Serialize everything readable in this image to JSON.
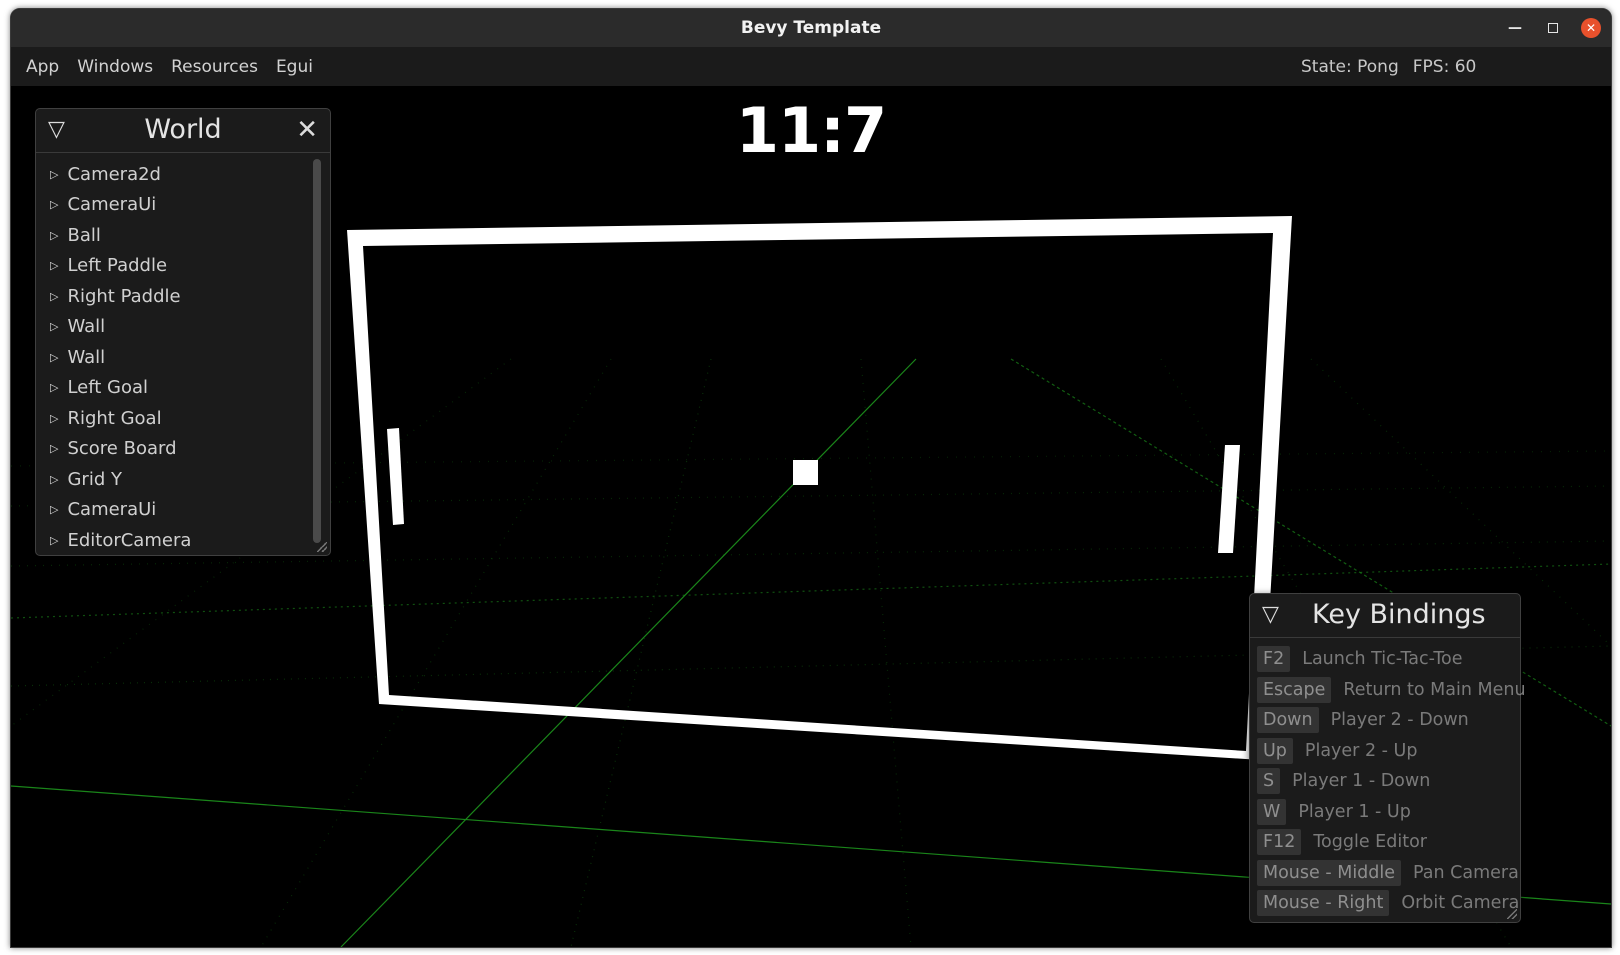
{
  "window": {
    "title": "Bevy Template"
  },
  "menubar": {
    "items": [
      "App",
      "Windows",
      "Resources",
      "Egui"
    ],
    "state": "State: Pong",
    "fps": "FPS: 60"
  },
  "game": {
    "score": "11:7",
    "colors": {
      "background": "#000000",
      "grid": "#1f9e1f",
      "pieces": "#ffffff"
    }
  },
  "world_panel": {
    "title": "World",
    "entities": [
      "Camera2d",
      "CameraUi",
      "Ball",
      "Left Paddle",
      "Right Paddle",
      "Wall",
      "Wall",
      "Left Goal",
      "Right Goal",
      "Score Board",
      "Grid Y",
      "CameraUi",
      "EditorCamera"
    ]
  },
  "key_bindings_panel": {
    "title": "Key Bindings",
    "bindings": [
      {
        "key": "F2",
        "action": "Launch Tic-Tac-Toe"
      },
      {
        "key": "Escape",
        "action": "Return to Main Menu"
      },
      {
        "key": "Down",
        "action": "Player 2 - Down"
      },
      {
        "key": "Up",
        "action": "Player 2 - Up"
      },
      {
        "key": "S",
        "action": "Player 1 - Down"
      },
      {
        "key": "W",
        "action": "Player 1 - Up"
      },
      {
        "key": "F12",
        "action": "Toggle Editor"
      },
      {
        "key": "Mouse - Middle",
        "action": "Pan Camera"
      },
      {
        "key": "Mouse - Right",
        "action": "Orbit Camera"
      }
    ]
  }
}
